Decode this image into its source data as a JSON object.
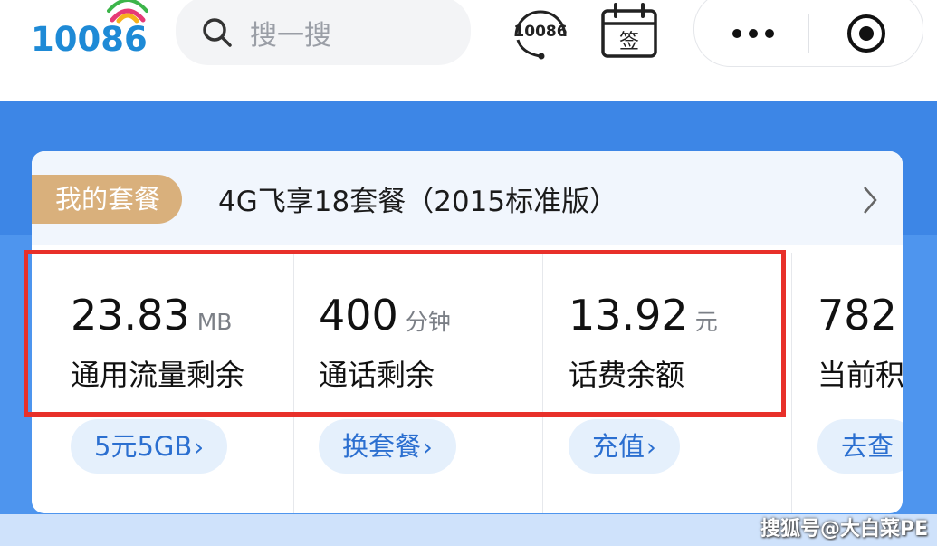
{
  "header": {
    "logo_text": "10086",
    "search_placeholder": "搜一搜",
    "service_icon_text": "10086",
    "calendar_icon_text": "签"
  },
  "package": {
    "badge": "我的套餐",
    "name": "4G飞享18套餐（2015标准版）"
  },
  "stats": [
    {
      "value": "23.83",
      "unit": "MB",
      "label": "通用流量剩余",
      "button": "5元5GB"
    },
    {
      "value": "400",
      "unit": "分钟",
      "label": "通话剩余",
      "button": "换套餐"
    },
    {
      "value": "13.92",
      "unit": "元",
      "label": "话费余额",
      "button": "充值"
    },
    {
      "value": "782",
      "unit": "",
      "label": "当前积",
      "button": "去查"
    }
  ],
  "watermark": "搜狐号@大白菜PE",
  "colors": {
    "brand_blue": "#1e8ad6",
    "band_blue": "#3d86e6",
    "badge_gold": "#d9b07c",
    "button_bg": "#e5f0fc",
    "button_text": "#2b6fd0",
    "highlight_red": "#e8302a"
  }
}
